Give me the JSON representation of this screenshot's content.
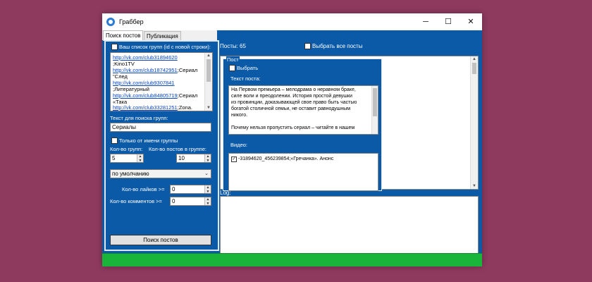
{
  "window": {
    "title": "Граббер",
    "controls": {
      "minimize": "─",
      "maximize": "☐",
      "close": "✕"
    }
  },
  "tabs": [
    {
      "label": "Поиск постов",
      "active": true
    },
    {
      "label": "Публикация",
      "active": false
    }
  ],
  "left": {
    "groups_checkbox_label": "Ваш список групп (id с новой строки):",
    "groups_lines": [
      {
        "link": "http://vk.com/club31894620",
        "text": ""
      },
      {
        "link": "",
        "text": ";Kino1TV"
      },
      {
        "link": "http://vk.com/club18742951",
        "text": ";Сериал"
      },
      {
        "link": "",
        "text": "\"След"
      },
      {
        "link": "http://vk.com/club9307841",
        "text": ""
      },
      {
        "link": "",
        "text": ";Литературный"
      },
      {
        "link": "http://vk.com/club84805719",
        "text": ";Сериал"
      },
      {
        "link": "",
        "text": "«Така"
      },
      {
        "link": "http://vk.com/club33281251",
        "text": ";Zona."
      }
    ],
    "search_text_label": "Текст для поиска групп:",
    "search_text_value": "Сериалы",
    "only_group_label": "Только от имени группы",
    "groups_count_label": "Кол-во групп:",
    "groups_count_value": "5",
    "posts_count_label": "Кол-во постов в группе:",
    "posts_count_value": "10",
    "sort_value": "по умолчанию",
    "likes_label": "Кол-во лайков >=",
    "likes_value": "0",
    "comments_label": "Кол-во комментов >=",
    "comments_value": "0",
    "search_button": "Поиск постов"
  },
  "right": {
    "posts_count": "Посты: 65",
    "select_all_label": "Выбрать все посты",
    "post": {
      "group_title": "Пост",
      "select_label": "Выбрать",
      "text_label": "Текст поста:",
      "text_lines": [
        "На Первом премьера – мелодрама о неравном браке,",
        "силе воли и преодолении. История простой девушки",
        "из провинции, доказывающей свое право быть частью",
        "богатой столичной семьи, не оставит равнодушным",
        "никого.",
        "",
        "Почему нельзя пропустить сериал – читайте в нашем"
      ],
      "video_label": "Видео:",
      "video_item": "-31894620_456239854;«Гречанка». Анонс"
    },
    "log_label": "Log:"
  },
  "status": {
    "progress": 1.0,
    "color": "#19b43a"
  }
}
